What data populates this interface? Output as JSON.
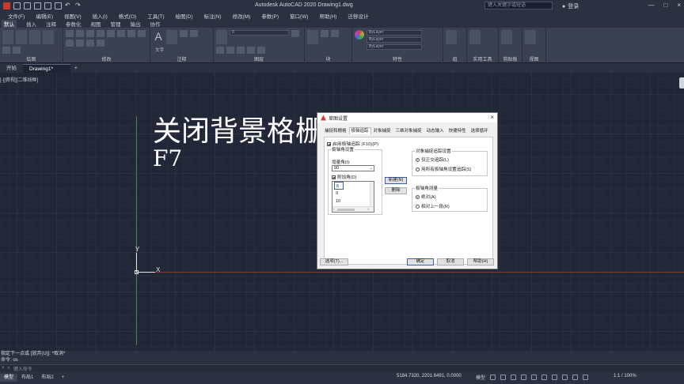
{
  "window": {
    "app_title": "Autodesk AutoCAD 2020    Drawing1.dwg",
    "search_placeholder": "键入关键字或短语",
    "login": "登录",
    "controls": {
      "min": "—",
      "max": "□",
      "close": "×"
    }
  },
  "menu": [
    "文件(F)",
    "编辑(E)",
    "视图(V)",
    "插入(I)",
    "格式(O)",
    "工具(T)",
    "绘图(D)",
    "标注(N)",
    "修改(M)",
    "参数(P)",
    "窗口(W)",
    "帮助(H)",
    "迁移设计"
  ],
  "ribbon_tabs": [
    "默认",
    "插入",
    "注释",
    "参数化",
    "视图",
    "管理",
    "输出",
    "协作"
  ],
  "ribbon_panels": [
    "绘图",
    "修改",
    "注释",
    "图层",
    "块",
    "特性",
    "组",
    "实用工具",
    "剪贴板",
    "视图"
  ],
  "ribbon_layer_value": "0",
  "ribbon_property_values": [
    "ByLayer",
    "ByLayer",
    "ByLayer"
  ],
  "ribbon_text_label": "文字",
  "file_tabs": {
    "start": "开始",
    "drawing": "Drawing1*",
    "new": "+"
  },
  "viewport_label": "[-][俯视][二维线框]",
  "overlay": {
    "line1": "关闭背景格栅",
    "line2": "F7"
  },
  "ucs": {
    "x": "X",
    "y": "Y"
  },
  "dialog": {
    "title": "草图设置",
    "tabs": [
      "捕捉和栅格",
      "极轴追踪",
      "对象捕捉",
      "三维对象捕捉",
      "动态输入",
      "快捷特性",
      "选择循环"
    ],
    "active_tab": 1,
    "enable_label": "启用极轴追踪 (F10)(P)",
    "enable_checked": true,
    "polar_group": {
      "legend": "极轴角设置",
      "increment_label": "增量角(I):",
      "increment_value": "90",
      "additional_label": "附加角(D)",
      "additional_checked": true,
      "angles": [
        "6",
        "9",
        "10"
      ],
      "new_button": "新建(N)",
      "delete_button": "删除"
    },
    "track_group": {
      "legend": "对象捕捉追踪设置",
      "option1": "仅正交追踪(L)",
      "option2": "用所有极轴角设置追踪(S)",
      "selected": 0
    },
    "measure_group": {
      "legend": "极轴角测量",
      "option1": "绝对(A)",
      "option2": "相对上一段(R)",
      "selected": 0
    },
    "buttons": {
      "options": "选项(T)...",
      "ok": "确定",
      "cancel": "取消",
      "help": "帮助(H)"
    }
  },
  "command": {
    "history1": "指定下一点或 [放弃(U)]: *取消*",
    "history2": "命令: os",
    "placeholder": "键入命令"
  },
  "layout_tabs": [
    "模型",
    "布局1",
    "布局2"
  ],
  "status": {
    "coords": "5184.7320, 2201.6491, 0.0000",
    "model": "模型",
    "zoom": "1:1 / 100%"
  }
}
